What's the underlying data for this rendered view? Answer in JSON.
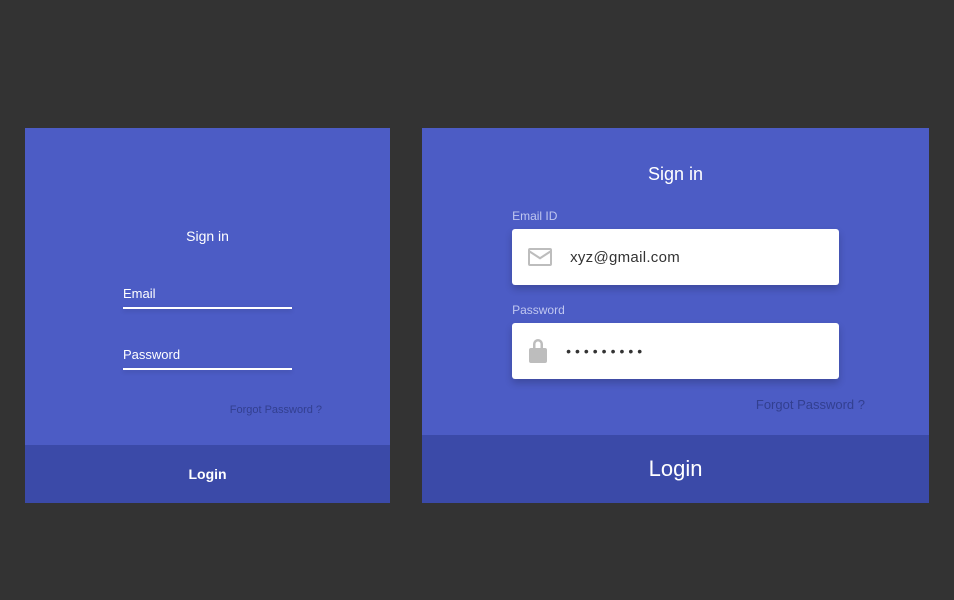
{
  "left": {
    "title": "Sign in",
    "email_label": "Email",
    "password_label": "Password",
    "forgot": "Forgot Password ?",
    "login": "Login"
  },
  "right": {
    "title": "Sign in",
    "email_label": "Email ID",
    "email_value": "xyz@gmail.com",
    "password_label": "Password",
    "password_value": "•••••••••",
    "forgot": "Forgot Password ?",
    "login": "Login"
  }
}
